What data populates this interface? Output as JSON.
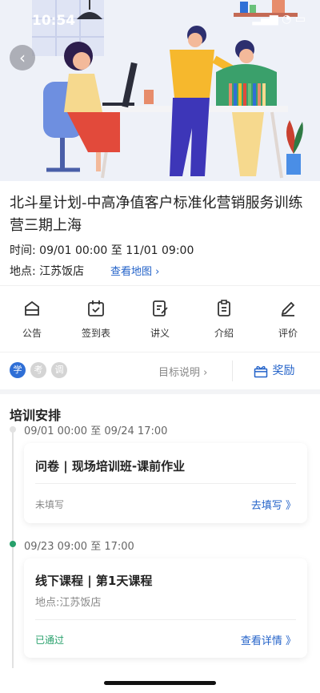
{
  "status_bar": {
    "time": "10:54"
  },
  "event": {
    "title": "北斗星计划-中高净值客户标准化营销服务训练营三期上海",
    "time_line": "时间: 09/01 00:00 至 11/01 09:00",
    "location_label": "地点: 江苏饭店",
    "map_link": "查看地图 ›"
  },
  "actions": [
    {
      "label": "公告",
      "icon": "announcement-icon"
    },
    {
      "label": "签到表",
      "icon": "calendar-check-icon"
    },
    {
      "label": "讲义",
      "icon": "handout-edit-icon"
    },
    {
      "label": "介绍",
      "icon": "clipboard-icon"
    },
    {
      "label": "评价",
      "icon": "pencil-icon"
    }
  ],
  "tags": [
    {
      "label": "学",
      "color": "#2f6fd6"
    },
    {
      "label": "考",
      "color": "#d4d4d4"
    },
    {
      "label": "调",
      "color": "#d4d4d4"
    }
  ],
  "goal_link": "目标说明 ›",
  "reward_label": "奖励",
  "schedule": {
    "heading": "培训安排",
    "items": [
      {
        "time": "09/01 00:00 至 09/24 17:00",
        "title": "问卷 |  现场培训班-课前作业",
        "status": "未填写",
        "status_color": "#888888",
        "action": "去填写 》"
      },
      {
        "time": "09/23 09:00 至 17:00",
        "title": "线下课程 |  第1天课程",
        "sub": "地点:江苏饭店",
        "status": "已通过",
        "status_color": "#27a06b",
        "action": "查看详情 》"
      }
    ]
  },
  "colors": {
    "accent": "#2463c9",
    "success": "#27a06b"
  }
}
